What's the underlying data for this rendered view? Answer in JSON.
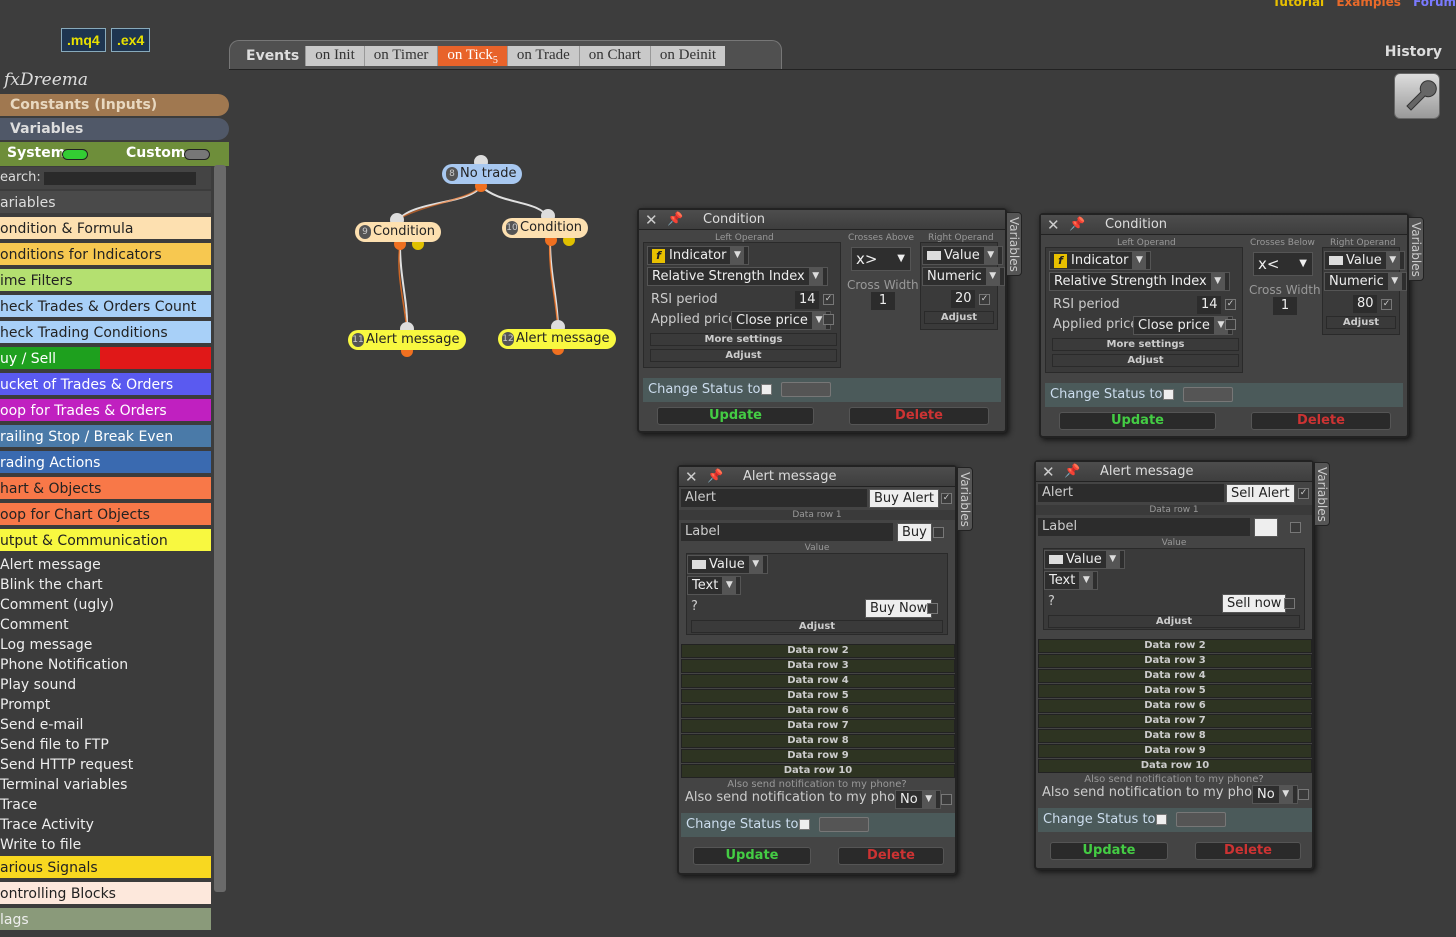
{
  "top": {
    "mq4_label": ".mq4",
    "ex4_label": ".ex4",
    "links": [
      {
        "label": "Tutorial",
        "color": "#e8c000"
      },
      {
        "label": "Examples",
        "color": "#e86a2a"
      },
      {
        "label": "Forum",
        "color": "#7a7aff"
      }
    ],
    "history_label": "History"
  },
  "events": {
    "label": "Events",
    "tabs": [
      {
        "label": "on Init",
        "badge": ""
      },
      {
        "label": "on Timer",
        "badge": ""
      },
      {
        "label": "on Tick",
        "badge": "5",
        "active": true
      },
      {
        "label": "on Trade",
        "badge": ""
      },
      {
        "label": "on Chart",
        "badge": ""
      },
      {
        "label": "on Deinit",
        "badge": ""
      }
    ]
  },
  "sidebar": {
    "logo": "fxDreema",
    "constants_label": "Constants (Inputs)",
    "variables_label": "Variables",
    "system_label": "System",
    "custom_label": "Custom",
    "search_label": "earch:",
    "categories": [
      {
        "label": "ariables",
        "bg": "#4a4a4a",
        "fg": "#ddd"
      },
      {
        "label": "ondition & Formula",
        "bg": "#fde0b0",
        "fg": "#222"
      },
      {
        "label": "onditions for Indicators",
        "bg": "#f7c850",
        "fg": "#222"
      },
      {
        "label": "ime Filters",
        "bg": "#b4e070",
        "fg": "#222"
      },
      {
        "label": "heck Trades & Orders Count",
        "bg": "#a8d0f8",
        "fg": "#222"
      },
      {
        "label": "heck Trading Conditions",
        "bg": "#a8d0f8",
        "fg": "#222"
      },
      {
        "label": "uy / Sell",
        "bg": "split",
        "fg": "#fff"
      },
      {
        "label": "ucket of Trades & Orders",
        "bg": "#5a5af0",
        "fg": "#fff"
      },
      {
        "label": "oop for Trades & Orders",
        "bg": "#c020c0",
        "fg": "#fff"
      },
      {
        "label": "railing Stop / Break Even",
        "bg": "#4a7aa8",
        "fg": "#fff"
      },
      {
        "label": "rading Actions",
        "bg": "#3a6ab0",
        "fg": "#fff"
      },
      {
        "label": "hart & Objects",
        "bg": "#f87848",
        "fg": "#222"
      },
      {
        "label": "oop for Chart Objects",
        "bg": "#f87848",
        "fg": "#222"
      },
      {
        "label": "utput & Communication",
        "bg": "#f8f840",
        "fg": "#222"
      }
    ],
    "blocks": [
      "Alert message",
      "Blink the chart",
      "Comment (ugly)",
      "Comment",
      "Log message",
      "Phone Notification",
      "Play sound",
      "Prompt",
      "Send e-mail",
      "Send file to FTP",
      "Send HTTP request",
      "Terminal variables",
      "Trace",
      "Trace Activity",
      "Write to file"
    ],
    "bottom_categories": [
      {
        "label": "arious Signals",
        "bg": "#f8d820",
        "fg": "#222"
      },
      {
        "label": "ontrolling Blocks",
        "bg": "#fde8dc",
        "fg": "#222"
      },
      {
        "label": "lags",
        "bg": "#8a9a7a",
        "fg": "#eee"
      }
    ]
  },
  "nodes": [
    {
      "num": "8",
      "label": "No trade",
      "bg": "#a8c8f0"
    },
    {
      "num": "9",
      "label": "Condition",
      "bg": "#fde0b0"
    },
    {
      "num": "10",
      "label": "Condition",
      "bg": "#fde0b0"
    },
    {
      "num": "11",
      "label": "Alert message",
      "bg": "#f8f840"
    },
    {
      "num": "12",
      "label": "Alert message",
      "bg": "#f8f840"
    }
  ],
  "cond_panels": [
    {
      "title": "Condition",
      "vtab": "Variables",
      "left_operand": "Left Operand",
      "op_label": "Crosses Above",
      "op_symbol": "x>",
      "right_operand": "Right Operand",
      "indicator": "Indicator",
      "indicator_name": "Relative Strength Index",
      "rsi_label": "RSI period",
      "rsi_value": "14",
      "applied_label": "Applied price",
      "applied_value": "Close price",
      "more_settings": "More settings",
      "adjust": "Adjust",
      "cross_width_label": "Cross Width",
      "cross_width": "1",
      "value_label": "Value",
      "numeric_label": "Numeric",
      "right_value": "20",
      "right_adjust": "Adjust",
      "status_label": "Change Status to",
      "update": "Update",
      "delete": "Delete"
    },
    {
      "title": "Condition",
      "vtab": "Variables",
      "left_operand": "Left Operand",
      "op_label": "Crosses Below",
      "op_symbol": "x<",
      "right_operand": "Right Operand",
      "indicator": "Indicator",
      "indicator_name": "Relative Strength Index",
      "rsi_label": "RSI period",
      "rsi_value": "14",
      "applied_label": "Applied price",
      "applied_value": "Close price",
      "more_settings": "More settings",
      "adjust": "Adjust",
      "cross_width_label": "Cross Width",
      "cross_width": "1",
      "value_label": "Value",
      "numeric_label": "Numeric",
      "right_value": "80",
      "right_adjust": "Adjust",
      "status_label": "Change Status to",
      "update": "Update",
      "delete": "Delete"
    }
  ],
  "alert_panels": [
    {
      "title": "Alert message",
      "vtab": "Variables",
      "alert_label": "Alert",
      "alert_value": "Buy Alert",
      "data_row_1": "Data row 1",
      "label_label": "Label",
      "label_value": "Buy",
      "value_caption": "Value",
      "value_dd": "Value",
      "text_dd": "Text",
      "q_label": "?",
      "q_value": "Buy Now",
      "adjust": "Adjust",
      "rows": [
        "Data row 2",
        "Data row 3",
        "Data row 4",
        "Data row 5",
        "Data row 6",
        "Data row 7",
        "Data row 8",
        "Data row 9",
        "Data row 10"
      ],
      "notif_caption": "Also send notification to my phone?",
      "notif_label": "Also send notification to my phone",
      "notif_value": "No",
      "status_label": "Change Status to",
      "update": "Update",
      "delete": "Delete"
    },
    {
      "title": "Alert message",
      "vtab": "Variables",
      "alert_label": "Alert",
      "alert_value": "Sell Alert",
      "data_row_1": "Data row 1",
      "label_label": "Label",
      "label_value": "",
      "value_caption": "Value",
      "value_dd": "Value",
      "text_dd": "Text",
      "q_label": "?",
      "q_value": "Sell now",
      "adjust": "Adjust",
      "rows": [
        "Data row 2",
        "Data row 3",
        "Data row 4",
        "Data row 5",
        "Data row 6",
        "Data row 7",
        "Data row 8",
        "Data row 9",
        "Data row 10"
      ],
      "notif_caption": "Also send notification to my phone?",
      "notif_label": "Also send notification to my phone",
      "notif_value": "No",
      "status_label": "Change Status to",
      "update": "Update",
      "delete": "Delete"
    }
  ]
}
